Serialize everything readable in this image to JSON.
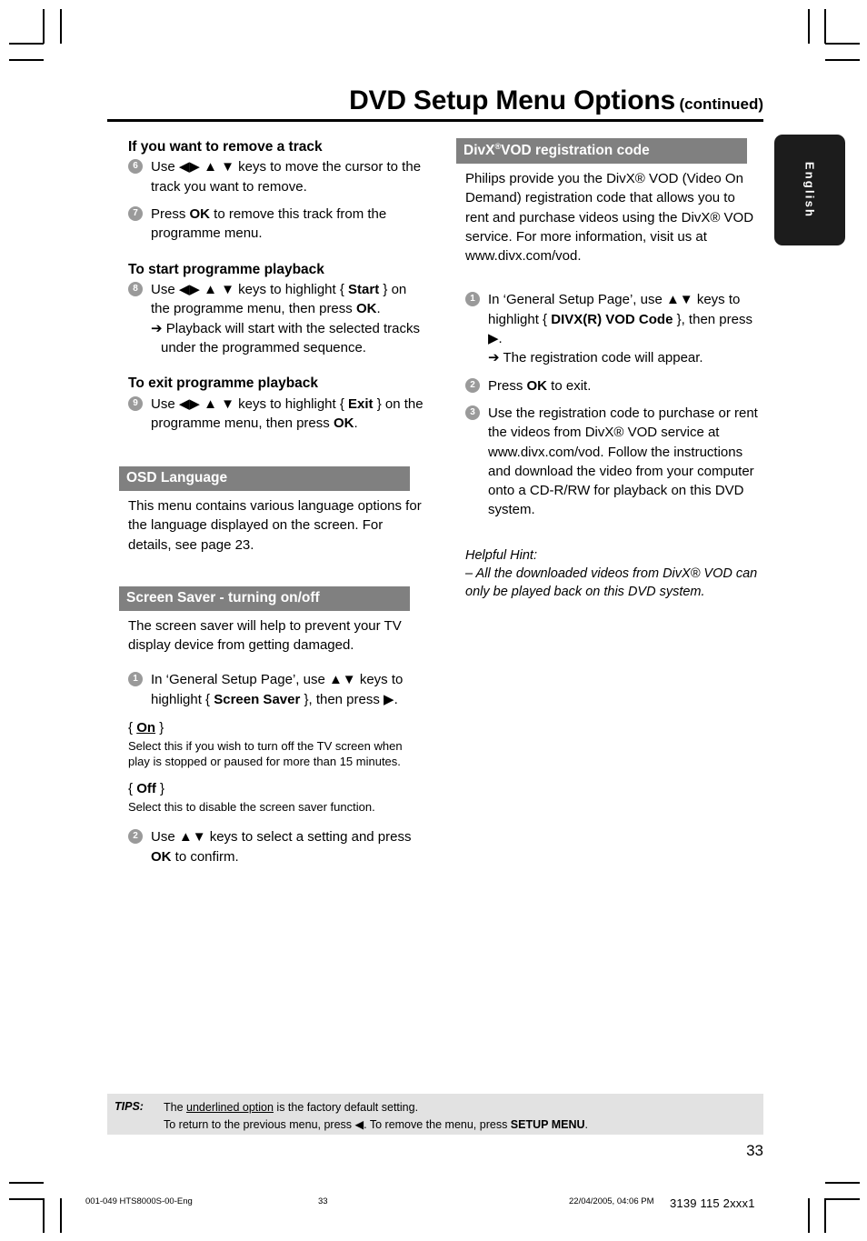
{
  "header": {
    "title_main": "DVD Setup Menu Options",
    "title_continued": "(continued)"
  },
  "language_tab": {
    "label": "English"
  },
  "left_column": {
    "remove_track": {
      "heading": "If you want to remove a track",
      "steps": [
        {
          "num": "6",
          "text": "Use ◀▶ ▲ ▼ keys to move the cursor to the track you want to remove."
        },
        {
          "num": "7",
          "text_pre": "Press ",
          "bold": "OK",
          "text_post": " to remove this track from the programme menu."
        }
      ]
    },
    "start_playback": {
      "heading": "To start programme playback",
      "step_num": "8",
      "line1_pre": "Use ◀▶ ▲ ▼ keys to highlight { ",
      "line1_bold": "Start",
      "line1_mid": " } on the programme menu, then press ",
      "line1_bold2": "OK",
      "line1_post": ".",
      "arrow_line": "➔ Playback will start with the selected tracks under the programmed sequence."
    },
    "exit_playback": {
      "heading": "To exit programme playback",
      "step_num": "9",
      "line_pre": "Use ◀▶ ▲ ▼ keys to highlight { ",
      "line_bold": "Exit",
      "line_mid": " } on the programme menu, then press ",
      "line_bold2": "OK",
      "line_post": "."
    },
    "osd_language": {
      "heading": "OSD Language",
      "body": "This menu contains various language options for the language displayed on the screen.  For details, see page 23."
    },
    "screen_saver": {
      "heading": "Screen Saver - turning on/off",
      "body": "The screen saver will help to prevent your TV display device from getting damaged.",
      "step1_num": "1",
      "step1_pre": "In ‘General Setup Page’, use ▲▼ keys to highlight { ",
      "step1_bold": "Screen Saver",
      "step1_post": " }, then press ▶.",
      "option_on_open": "{ ",
      "option_on": "On",
      "option_on_close": " }",
      "option_on_desc": "Select this if you wish to turn off the TV screen when play is stopped or paused for more than 15 minutes.",
      "option_off_open": "{ ",
      "option_off": "Off",
      "option_off_close": " }",
      "option_off_desc": "Select this to disable the screen saver function.",
      "step2_num": "2",
      "step2_pre": "Use ▲▼ keys to select a setting and press ",
      "step2_bold": "OK",
      "step2_post": " to confirm."
    }
  },
  "right_column": {
    "divx_vod": {
      "heading_pre": "DivX",
      "heading_sup": "®",
      "heading_post": "VOD registration code",
      "body": "Philips provide you the DivX® VOD (Video On Demand) registration code that allows you to rent and purchase videos using the DivX® VOD service. For more information, visit us at www.divx.com/vod.",
      "step1_num": "1",
      "step1_pre": "In ‘General Setup Page’, use ▲▼ keys to highlight { ",
      "step1_bold": "DIVX(R) VOD Code",
      "step1_post": " }, then press ▶.",
      "step1_arrow": "➔ The registration code will appear.",
      "step2_num": "2",
      "step2_pre": "Press ",
      "step2_bold": "OK",
      "step2_post": " to exit.",
      "step3_num": "3",
      "step3_text": "Use the registration code to purchase or rent the videos from DivX® VOD service at www.divx.com/vod.  Follow the instructions and download the video from your computer onto a CD-R/RW for playback on this DVD system.",
      "hint_title": "Helpful Hint:",
      "hint_body": "–  All the downloaded videos from DivX® VOD can only be played back on this DVD system."
    }
  },
  "tips": {
    "label": "TIPS:",
    "line1_pre": "The ",
    "line1_underlined": "underlined option",
    "line1_post": " is the factory default setting.",
    "line2_pre": "To return to the previous menu, press ◀.  To remove the menu, press ",
    "line2_bold": "SETUP MENU",
    "line2_post": "."
  },
  "page_number": "33",
  "print_footer": {
    "file_name": "001-049 HTS8000S-00-Eng",
    "page": "33",
    "timestamp": "22/04/2005, 04:06 PM",
    "doc_code": "3139 115 2xxx1"
  },
  "colors": {
    "section_bar": "#808080",
    "tips_bg": "#e2e2e2",
    "step_badge": "#9a9a9a",
    "language_tab": "#1c1c1c"
  }
}
